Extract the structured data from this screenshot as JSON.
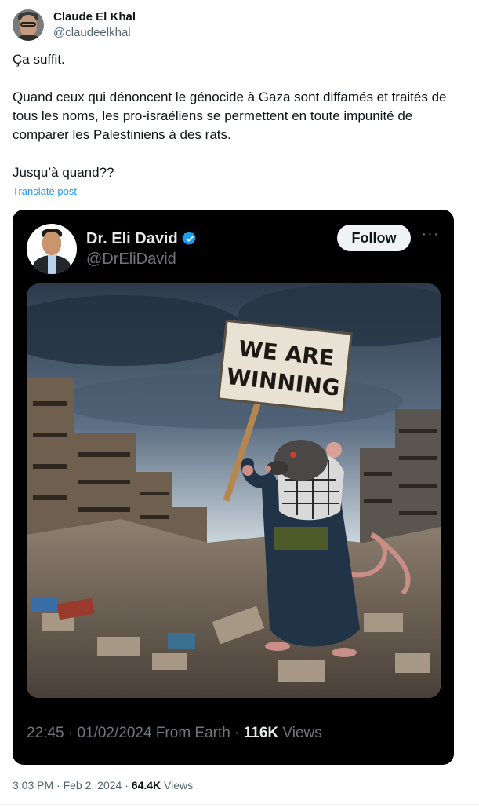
{
  "author": {
    "display_name": "Claude El Khal",
    "handle": "@claudeelkhal"
  },
  "tweet": {
    "lines": [
      "Ça suffit.",
      "Quand ceux qui dénoncent le génocide à Gaza sont diffamés et traités de tous les noms, les pro-israéliens se permettent en toute impunité de comparer les Palestiniens à des rats.",
      "Jusqu’à quand??"
    ],
    "translate_label": "Translate post"
  },
  "quoted": {
    "display_name": "Dr. Eli David",
    "handle": "@DrEliDavid",
    "follow_label": "Follow",
    "more_label": "···",
    "sign_text_1": "WE ARE",
    "sign_text_2": "WINNING",
    "time": "22:45",
    "separator": "·",
    "date": "01/02/2024",
    "source": "From Earth",
    "views_count": "116K",
    "views_label": "Views"
  },
  "footer": {
    "time": "3:03 PM",
    "separator": "·",
    "date": "Feb 2, 2024",
    "views_count": "64.4K",
    "views_label": "Views"
  },
  "colors": {
    "link_blue": "#1d9bf0",
    "verified_blue": "#1d9bf0",
    "card_background": "#000000",
    "follow_button": "#eff3f4"
  }
}
